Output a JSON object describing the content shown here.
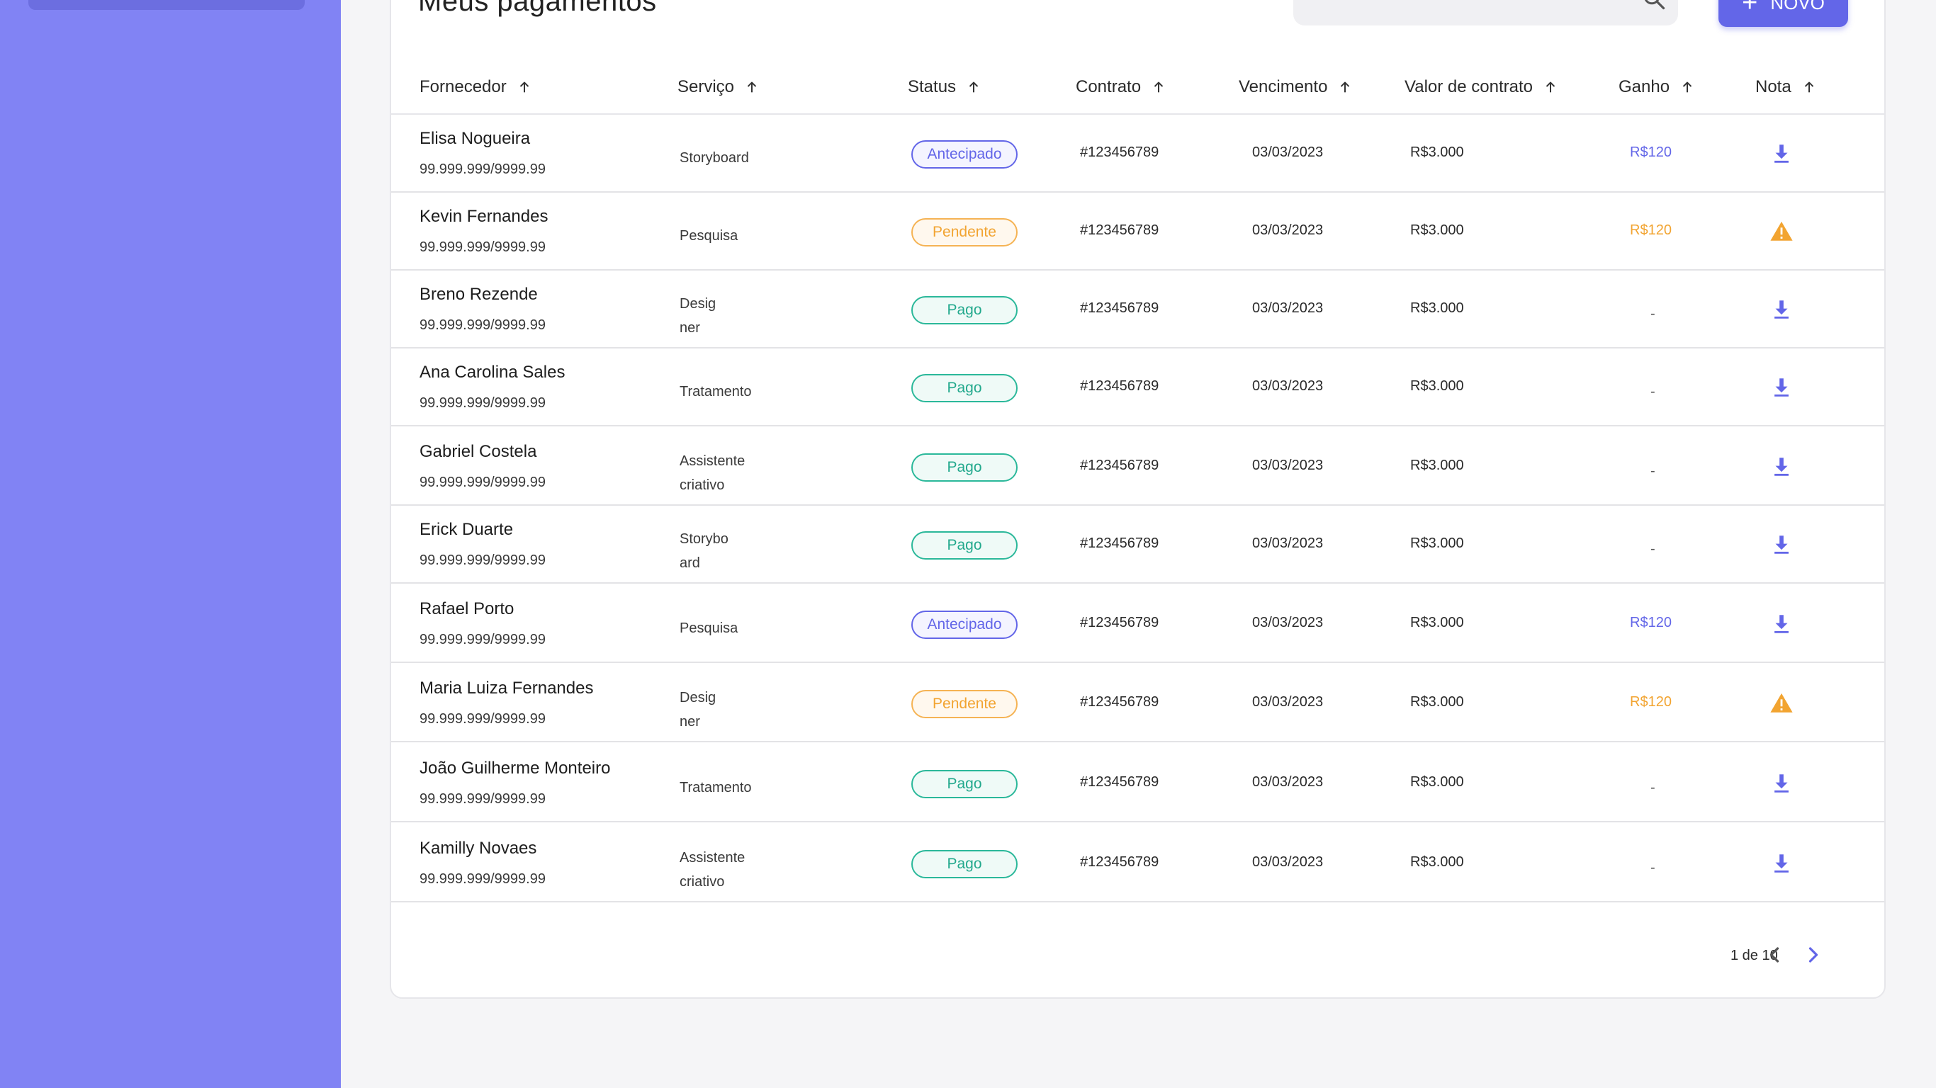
{
  "page": {
    "title": "Meus pagamentos",
    "search_placeholder": "",
    "new_button_label": "NOVO"
  },
  "columns": [
    {
      "label": "Fornecedor"
    },
    {
      "label": "Serviço"
    },
    {
      "label": "Status"
    },
    {
      "label": "Contrato"
    },
    {
      "label": "Vencimento"
    },
    {
      "label": "Valor de contrato"
    },
    {
      "label": "Ganho"
    },
    {
      "label": "Nota"
    }
  ],
  "rows": [
    {
      "name": "Elisa Nogueira",
      "doc": "99.999.999/9999.99",
      "service": [
        "Storyboard"
      ],
      "status": "Antecipado",
      "contract": "#123456789",
      "due": "03/03/2023",
      "value": "R$3.000",
      "gain": "R$120",
      "note_icon": "download-icon"
    },
    {
      "name": "Kevin Fernandes",
      "doc": "99.999.999/9999.99",
      "service": [
        "Pesquisa"
      ],
      "status": "Pendente",
      "contract": "#123456789",
      "due": "03/03/2023",
      "value": "R$3.000",
      "gain": "R$120",
      "note_icon": "warning-icon"
    },
    {
      "name": "Breno Rezende",
      "doc": "99.999.999/9999.99",
      "service": [
        "Desig",
        "ner"
      ],
      "status": "Pago",
      "contract": "#123456789",
      "due": "03/03/2023",
      "value": "R$3.000",
      "gain": "-",
      "note_icon": "download-icon"
    },
    {
      "name": "Ana Carolina Sales",
      "doc": "99.999.999/9999.99",
      "service": [
        "Tratamento"
      ],
      "status": "Pago",
      "contract": "#123456789",
      "due": "03/03/2023",
      "value": "R$3.000",
      "gain": "-",
      "note_icon": "download-icon"
    },
    {
      "name": "Gabriel Costela",
      "doc": "99.999.999/9999.99",
      "service": [
        "Assistente",
        "criativo"
      ],
      "status": "Pago",
      "contract": "#123456789",
      "due": "03/03/2023",
      "value": "R$3.000",
      "gain": "-",
      "note_icon": "download-icon"
    },
    {
      "name": "Erick Duarte",
      "doc": "99.999.999/9999.99",
      "service": [
        "Storybo",
        "ard"
      ],
      "status": "Pago",
      "contract": "#123456789",
      "due": "03/03/2023",
      "value": "R$3.000",
      "gain": "-",
      "note_icon": "download-icon"
    },
    {
      "name": "Rafael Porto",
      "doc": "99.999.999/9999.99",
      "service": [
        "Pesquisa"
      ],
      "status": "Antecipado",
      "contract": "#123456789",
      "due": "03/03/2023",
      "value": "R$3.000",
      "gain": "R$120",
      "note_icon": "download-icon"
    },
    {
      "name": "Maria Luiza Fernandes",
      "doc": "99.999.999/9999.99",
      "service": [
        "Desig",
        "ner"
      ],
      "status": "Pendente",
      "contract": "#123456789",
      "due": "03/03/2023",
      "value": "R$3.000",
      "gain": "R$120",
      "note_icon": "warning-icon"
    },
    {
      "name": "João Guilherme Monteiro",
      "doc": "99.999.999/9999.99",
      "service": [
        "Tratamento"
      ],
      "status": "Pago",
      "contract": "#123456789",
      "due": "03/03/2023",
      "value": "R$3.000",
      "gain": "-",
      "note_icon": "download-icon"
    },
    {
      "name": "Kamilly Novaes",
      "doc": "99.999.999/9999.99",
      "service": [
        "Assistente",
        "criativo"
      ],
      "status": "Pago",
      "contract": "#123456789",
      "due": "03/03/2023",
      "value": "R$3.000",
      "gain": "-",
      "note_icon": "download-icon"
    }
  ],
  "pagination": {
    "text": "1 de 10"
  },
  "colors": {
    "accent": "#6366e8",
    "sidebar": "#8183f4",
    "pending": "#f2a431",
    "paid": "#23a98d"
  }
}
